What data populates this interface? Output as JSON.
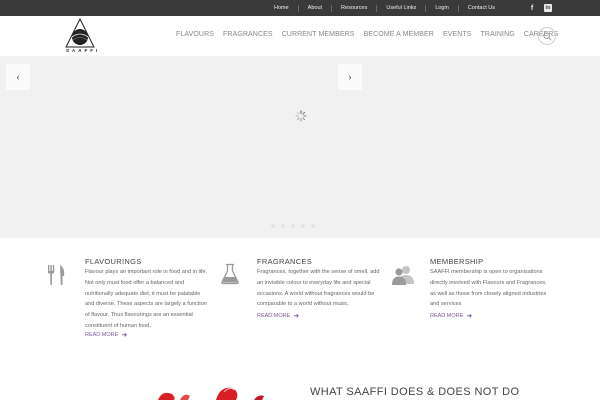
{
  "topbar": {
    "links": [
      "Home",
      "About",
      "Resources",
      "Useful Links",
      "Login",
      "Contact Us"
    ],
    "social": [
      "facebook-icon",
      "linkedin-icon"
    ]
  },
  "header": {
    "logo_text": "SAAFFI",
    "nav": [
      "FLAVOURS",
      "FRAGRANCES",
      "CURRENT MEMBERS",
      "BECOME A MEMBER",
      "EVENTS",
      "TRAINING",
      "CAREERS"
    ],
    "search_icon": "search-icon"
  },
  "hero": {
    "prev_icon": "chevron-left-icon",
    "next_icon": "chevron-right-icon",
    "loading_icon": "spinner-icon",
    "slide_count": 5
  },
  "features": [
    {
      "icon": "cutlery-icon",
      "title": "FLAVOURINGS",
      "lines": [
        "Flavour plays an important role in food and in life.",
        "Not only must food offer a balanced and",
        "nutritionally adequate diet, it must be palatable",
        "and diverse. These aspects are largely a function",
        "of flavour. Thus flavourings are an essential",
        "constituent of human food."
      ],
      "more": "READ MORE"
    },
    {
      "icon": "flask-icon",
      "title": "FRAGRANCES",
      "lines": [
        "Fragrances, together with the sense of smell, add",
        "an invisible colour to everyday life and special",
        "occasions.  A world without fragrances would be",
        "comparable to a world without music."
      ],
      "more": "READ MORE"
    },
    {
      "icon": "users-icon",
      "title": "MEMBERSHIP",
      "lines": [
        "SAAFFI membership is open to organisations",
        "directly involved with Flavours and Fragrances,",
        "as well as those from closely aligned industries",
        "and services"
      ],
      "more": "READ MORE"
    }
  ],
  "section": {
    "title": "WHAT SAAFFI DOES & DOES NOT DO"
  },
  "colors": {
    "topbar": "#3a3a3a",
    "accent": "#7d5a9e",
    "hero_bg": "#f1f1f1"
  }
}
